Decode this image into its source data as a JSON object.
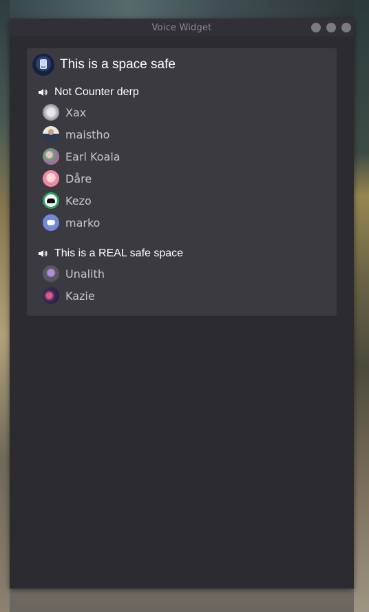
{
  "window": {
    "title": "Voice Widget"
  },
  "server": {
    "name": "This is a space safe",
    "icon": "server-icon"
  },
  "channels": [
    {
      "name": "Not Counter derp",
      "icon": "speaker-icon",
      "users": [
        {
          "name": "Xax"
        },
        {
          "name": "maistho"
        },
        {
          "name": "Earl Koala"
        },
        {
          "name": "Dåre"
        },
        {
          "name": "Kezo",
          "speaking": true
        },
        {
          "name": "marko"
        }
      ]
    },
    {
      "name": "This is a REAL safe space",
      "icon": "speaker-icon",
      "users": [
        {
          "name": "Unalith"
        },
        {
          "name": "Kazie"
        }
      ]
    }
  ],
  "colors": {
    "window_bg": "#2b2b30",
    "panel_bg": "#3a3a40",
    "speaking_ring": "#2fa36a",
    "text_primary": "#ffffff",
    "text_secondary": "#c6c6cc"
  }
}
